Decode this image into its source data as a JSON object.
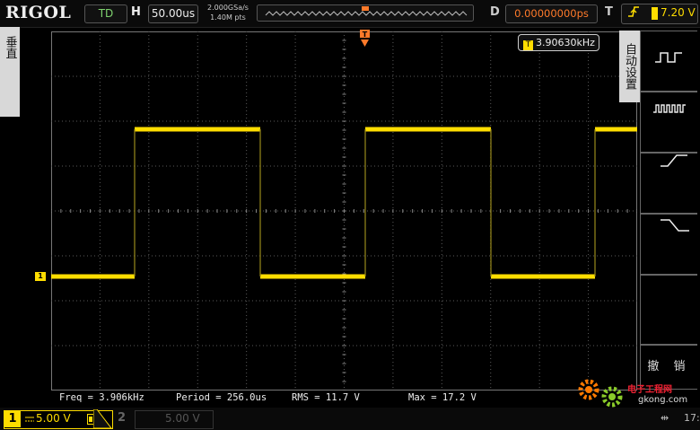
{
  "top_bar": {
    "logo": "RIGOL",
    "run_state": "TD",
    "horizontal_label": "H",
    "timebase": "50.00us",
    "sample_rate": "2.000GSa/s",
    "memory_depth": "1.40M pts",
    "delay_label": "D",
    "delay_value": "0.00000000ps",
    "trigger_label": "T",
    "trigger_level": "7.20 V",
    "trigger_marker": "T"
  },
  "left_menu": {
    "tab_label": "垂直"
  },
  "right_menu": {
    "title": "自动设置",
    "options": [
      "single-period-icon",
      "multi-period-icon",
      "rising-edge-icon",
      "falling-edge-icon"
    ],
    "cancel_label": "撤 销"
  },
  "freq_readout": {
    "prefix": "T",
    "value": "3.90630kHz"
  },
  "channel_marker": "1",
  "measurements": [
    {
      "label": "Freq = 3.906kHz"
    },
    {
      "label": "Period = 256.0us"
    },
    {
      "label": "RMS = 11.7 V"
    },
    {
      "label": "Max = 17.2 V"
    }
  ],
  "bottom_bar": {
    "ch1_number": "1",
    "ch1_scale": "5.00 V",
    "ch2_number": "2",
    "ch2_scale": "5.00 V",
    "clock": "17:"
  },
  "watermark": {
    "text": "电子工程网",
    "url": "gkong.com"
  },
  "colors": {
    "ch1": "#ffdd00",
    "delay": "#ff7a2a",
    "trigger": "#ffdd00",
    "grid": "#5a5a5a"
  }
}
